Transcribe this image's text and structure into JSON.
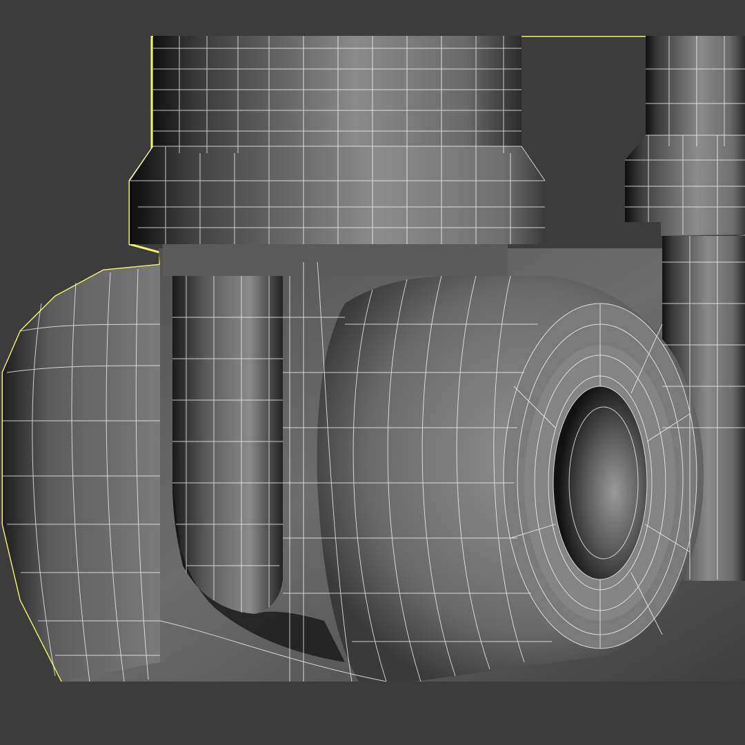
{
  "viewport": {
    "background_color": "#3c3c3c",
    "selection_outline_color": "#f2f26a",
    "wire_color": "#ffffff",
    "shading_mode": "wireframe-on-shaded",
    "selected": true
  },
  "scene": {
    "objects": [
      "left-vertical-tube",
      "left-tube-collar",
      "right-vertical-tube",
      "right-tube-collar",
      "bridge-body",
      "main-ring-boss",
      "ring-bore",
      "left-side-boss",
      "slotted-cutout"
    ]
  }
}
